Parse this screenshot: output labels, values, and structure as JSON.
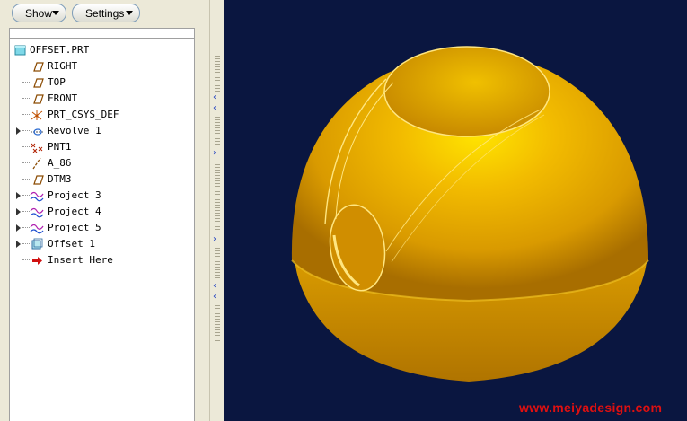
{
  "toolbar": {
    "show_label": "Show",
    "settings_label": "Settings"
  },
  "tree": {
    "root": "OFFSET.PRT",
    "items": [
      {
        "label": "RIGHT",
        "icon": "datum-plane-icon",
        "expandable": false
      },
      {
        "label": "TOP",
        "icon": "datum-plane-icon",
        "expandable": false
      },
      {
        "label": "FRONT",
        "icon": "datum-plane-icon",
        "expandable": false
      },
      {
        "label": "PRT_CSYS_DEF",
        "icon": "coordinate-system-icon",
        "expandable": false
      },
      {
        "label": "Revolve 1",
        "icon": "revolve-icon",
        "expandable": true
      },
      {
        "label": "PNT1",
        "icon": "datum-point-icon",
        "expandable": false
      },
      {
        "label": "A_86",
        "icon": "datum-axis-icon",
        "expandable": false
      },
      {
        "label": "DTM3",
        "icon": "datum-plane-icon",
        "expandable": false
      },
      {
        "label": "Project 3",
        "icon": "project-curve-icon",
        "expandable": true
      },
      {
        "label": "Project 4",
        "icon": "project-curve-icon",
        "expandable": true
      },
      {
        "label": "Project 5",
        "icon": "project-curve-icon",
        "expandable": true
      },
      {
        "label": "Offset 1",
        "icon": "offset-icon",
        "expandable": true
      },
      {
        "label": "Insert Here",
        "icon": "insert-arrow-icon",
        "expandable": false
      }
    ]
  },
  "colors": {
    "viewport_bg": "#0a1640",
    "model": "#e0a000",
    "watermark": "#e01010"
  },
  "watermark": "www.meiyadesign.com"
}
